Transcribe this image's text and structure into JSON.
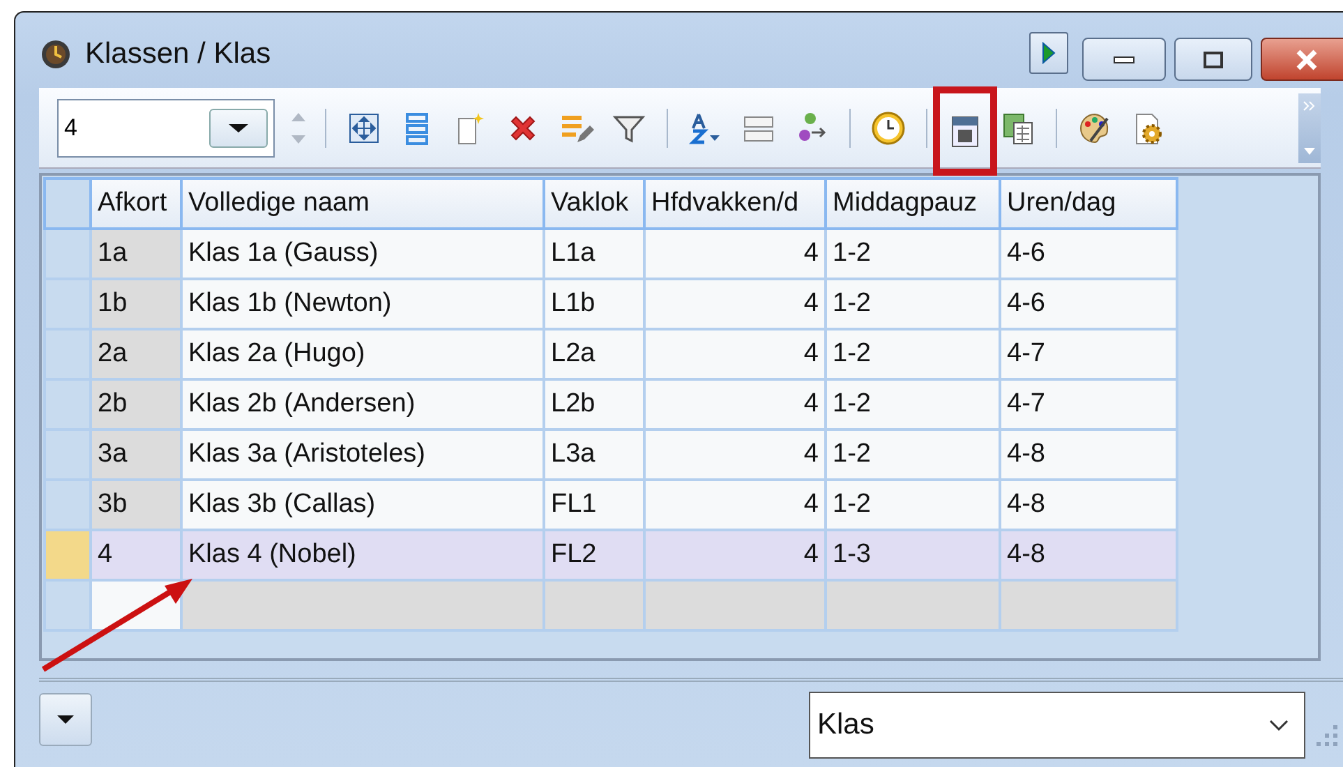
{
  "window": {
    "title": "Klassen / Klas"
  },
  "toolbar": {
    "value": "4",
    "tools": [
      {
        "kind": "move",
        "highlighted": false
      },
      {
        "kind": "rows",
        "highlighted": false
      },
      {
        "kind": "new",
        "highlighted": false
      },
      {
        "kind": "delete",
        "highlighted": false
      },
      {
        "kind": "edit",
        "highlighted": false
      },
      {
        "kind": "filter",
        "highlighted": false
      },
      {
        "kind": "sort",
        "highlighted": false
      },
      {
        "kind": "fields",
        "highlighted": false
      },
      {
        "kind": "links",
        "highlighted": false
      },
      {
        "kind": "clock",
        "highlighted": false
      },
      {
        "kind": "calendar",
        "highlighted": true
      },
      {
        "kind": "sheet",
        "highlighted": false
      },
      {
        "kind": "palette",
        "highlighted": false
      },
      {
        "kind": "settings",
        "highlighted": false
      }
    ]
  },
  "table": {
    "columns": [
      "Afkort",
      "Volledige naam",
      "Vaklok",
      "Hfdvakken/d",
      "Middagpauz",
      "Uren/dag"
    ],
    "rows": [
      {
        "cells": [
          "1a",
          "Klas 1a (Gauss)",
          "L1a",
          "4",
          "1-2",
          "4-6"
        ],
        "selected": false
      },
      {
        "cells": [
          "1b",
          "Klas 1b (Newton)",
          "L1b",
          "4",
          "1-2",
          "4-6"
        ],
        "selected": false
      },
      {
        "cells": [
          "2a",
          "Klas 2a (Hugo)",
          "L2a",
          "4",
          "1-2",
          "4-7"
        ],
        "selected": false
      },
      {
        "cells": [
          "2b",
          "Klas 2b (Andersen)",
          "L2b",
          "4",
          "1-2",
          "4-7"
        ],
        "selected": false
      },
      {
        "cells": [
          "3a",
          "Klas 3a (Aristoteles)",
          "L3a",
          "4",
          "1-2",
          "4-8"
        ],
        "selected": false
      },
      {
        "cells": [
          "3b",
          "Klas 3b (Callas)",
          "FL1",
          "4",
          "1-2",
          "4-8"
        ],
        "selected": false
      },
      {
        "cells": [
          "4",
          "Klas 4 (Nobel)",
          "FL2",
          "4",
          "1-3",
          "4-8"
        ],
        "selected": true
      }
    ]
  },
  "footer": {
    "view": "Klas"
  }
}
